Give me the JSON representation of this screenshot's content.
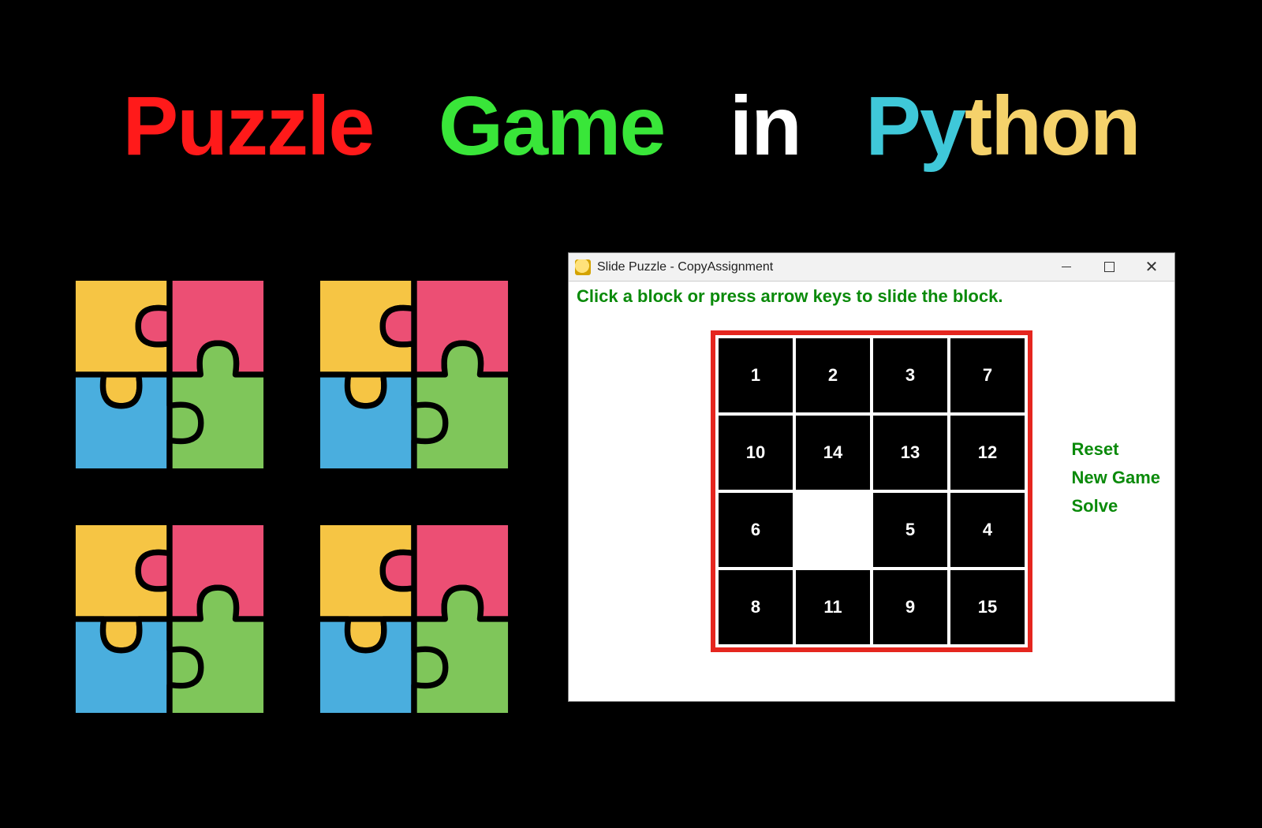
{
  "headline": {
    "w1": "Puzzle",
    "w2": "Game",
    "w3": "in",
    "w4a": "Py",
    "w4b": "thon"
  },
  "jigsaw": {
    "colors": {
      "yellow": "#f6c544",
      "pink": "#ec4f74",
      "blue": "#4aaede",
      "green": "#7fc65a",
      "stroke": "#000000"
    }
  },
  "window": {
    "title": "Slide Puzzle - CopyAssignment",
    "hint": "Click a block or press arrow keys to slide the block.",
    "commands": {
      "reset": "Reset",
      "new_game": "New Game",
      "solve": "Solve"
    },
    "board": [
      [
        "1",
        "2",
        "3",
        "7"
      ],
      [
        "10",
        "14",
        "13",
        "12"
      ],
      [
        "6",
        "",
        "5",
        "4"
      ],
      [
        "8",
        "11",
        "9",
        "15"
      ]
    ]
  }
}
